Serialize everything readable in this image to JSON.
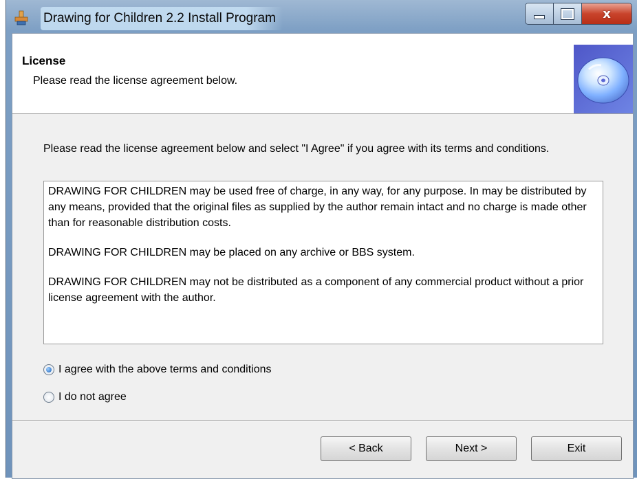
{
  "window": {
    "title": "Drawing for Children 2.2 Install Program",
    "controls": {
      "minimize_icon": "minimize-icon",
      "maximize_icon": "maximize-icon",
      "close_label": "x"
    }
  },
  "header": {
    "title": "License",
    "subtitle": "Please read the license agreement below.",
    "icon": "cd-disc-icon"
  },
  "instructions": "Please read the license agreement below and select \"I Agree\" if you agree with its terms and conditions.",
  "license": {
    "paragraphs": [
      " DRAWING FOR CHILDREN may be used free of charge, in any way, for any purpose. In may be distributed by any means, provided that the original files as supplied by the author remain intact and no charge is made other than for reasonable distribution costs.",
      "DRAWING FOR CHILDREN may be placed on any archive or BBS system.",
      "DRAWING FOR CHILDREN may not be distributed as a component of any commercial product without a prior license agreement with the author."
    ]
  },
  "options": {
    "agree_label": "I agree with the above terms and conditions",
    "disagree_label": "I do not agree",
    "selected": "agree"
  },
  "buttons": {
    "back": "< Back",
    "next": "Next >",
    "exit": "Exit"
  },
  "colors": {
    "close_button": "#c9442c",
    "title_bar": "#7d9fc4",
    "cd_panel": "#5b66d4",
    "radio_selected": "#1a5fb8"
  }
}
